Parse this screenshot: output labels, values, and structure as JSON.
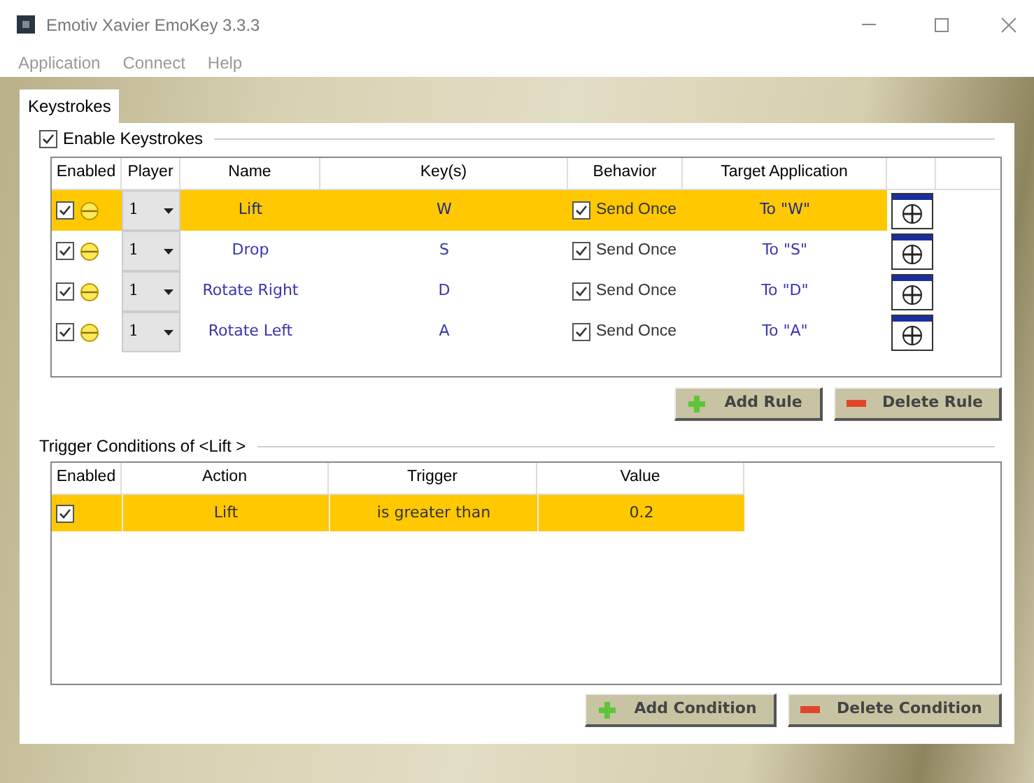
{
  "window": {
    "title": "Emotiv Xavier EmoKey 3.3.3"
  },
  "menu": [
    "Application",
    "Connect",
    "Help"
  ],
  "tabs": [
    {
      "label": "Keystrokes",
      "selected": true
    }
  ],
  "enable_keystrokes": {
    "label": "Enable Keystrokes",
    "checked": true
  },
  "rules_table": {
    "columns": [
      "Enabled",
      "Player",
      "Name",
      "Key(s)",
      "Behavior",
      "Target Application"
    ],
    "rows": [
      {
        "enabled": true,
        "selected": true,
        "player": "1",
        "name": "Lift",
        "keys": "W",
        "send_once": true,
        "behavior": "Send Once",
        "target": "To \"W\""
      },
      {
        "enabled": true,
        "selected": false,
        "player": "1",
        "name": "Drop",
        "keys": "S",
        "send_once": true,
        "behavior": "Send Once",
        "target": "To \"S\""
      },
      {
        "enabled": true,
        "selected": false,
        "player": "1",
        "name": "Rotate Right",
        "keys": "D",
        "send_once": true,
        "behavior": "Send Once",
        "target": "To \"D\""
      },
      {
        "enabled": true,
        "selected": false,
        "player": "1",
        "name": "Rotate Left",
        "keys": "A",
        "send_once": true,
        "behavior": "Send Once",
        "target": "To \"A\""
      }
    ]
  },
  "rule_buttons": [
    {
      "label": "Add Rule",
      "kind": "add"
    },
    {
      "label": "Delete Rule",
      "kind": "delete"
    }
  ],
  "conditions_title": "Trigger Conditions of <Lift >",
  "conditions_table": {
    "columns": [
      "Enabled",
      "Action",
      "Trigger",
      "Value"
    ],
    "rows": [
      {
        "enabled": true,
        "selected": true,
        "action": "Lift",
        "trigger": "is greater than",
        "value": "0.2"
      }
    ]
  },
  "condition_buttons": [
    {
      "label": "Add Condition",
      "kind": "add"
    },
    {
      "label": "Delete Condition",
      "kind": "delete"
    }
  ]
}
